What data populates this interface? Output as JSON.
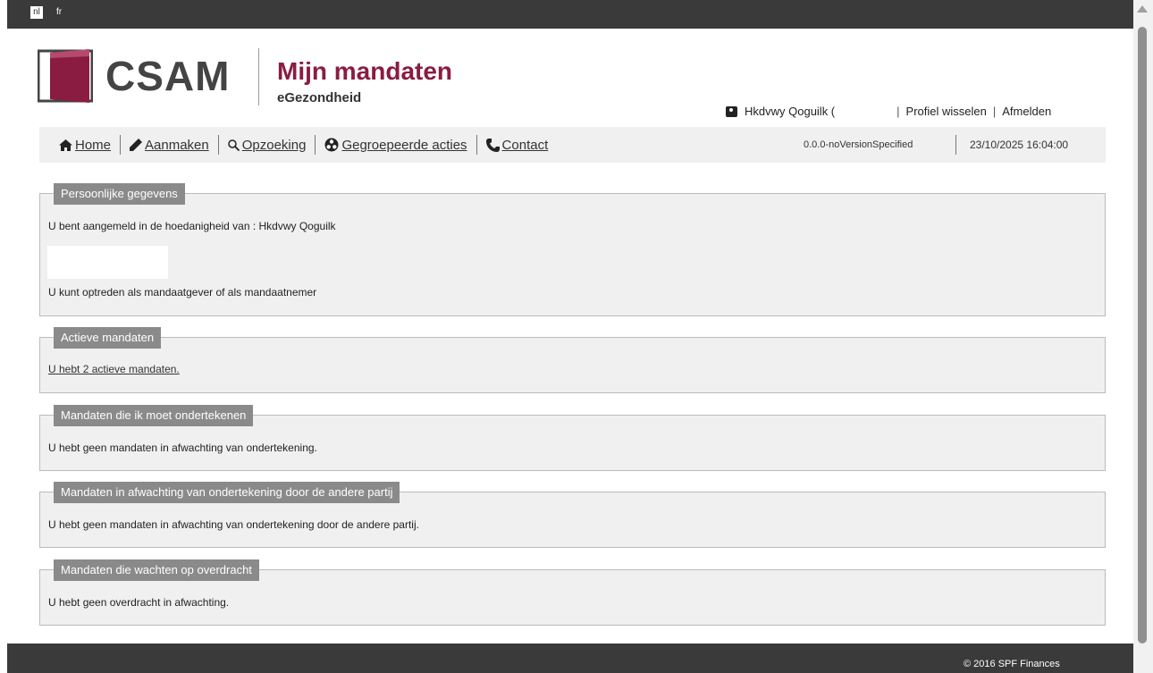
{
  "langbar": {
    "languages": [
      "nl",
      "fr"
    ],
    "active": "nl"
  },
  "header": {
    "logo_text": "CSAM",
    "title": "Mijn mandaten",
    "subtitle": "eGezondheid",
    "user_name": "Hkdvwy Qoguilk (",
    "switch_profile": "Profiel wisselen",
    "logout": "Afmelden",
    "separator": "|"
  },
  "nav": {
    "items": [
      {
        "label": "Home",
        "icon": "home-icon"
      },
      {
        "label": "Aanmaken",
        "icon": "pencil-icon"
      },
      {
        "label": "Opzoeking",
        "icon": "search-icon"
      },
      {
        "label": "Gegroepeerde acties",
        "icon": "group-actions-icon"
      },
      {
        "label": "Contact",
        "icon": "phone-icon"
      }
    ],
    "version": "0.0.0-noVersionSpecified",
    "datetime": "23/10/2025 16:04:00"
  },
  "panels": {
    "personal": {
      "title": "Persoonlijke gegevens",
      "line1": "U bent aangemeld in de hoedanigheid van : Hkdvwy Qoguilk",
      "line2": "U kunt optreden als mandaatgever of als mandaatnemer"
    },
    "active": {
      "title": "Actieve mandaten",
      "link": "U hebt 2 actieve mandaten."
    },
    "to_sign": {
      "title": "Mandaten die ik moet ondertekenen",
      "text": "U hebt geen mandaten in afwachting van ondertekening."
    },
    "other_party": {
      "title": "Mandaten in afwachting van ondertekening door de andere partij",
      "text": "U hebt geen mandaten in afwachting van ondertekening door de andere partij."
    },
    "transfer": {
      "title": "Mandaten die wachten op overdracht",
      "text": "U hebt geen overdracht in afwachting."
    }
  },
  "footer": {
    "copyright": "© 2016 SPF Finances"
  },
  "colors": {
    "brand": "#8a1c41",
    "bar": "#3a3a3a",
    "panel_bg": "#f0f0f0",
    "legend_bg": "#8a8a8a"
  }
}
